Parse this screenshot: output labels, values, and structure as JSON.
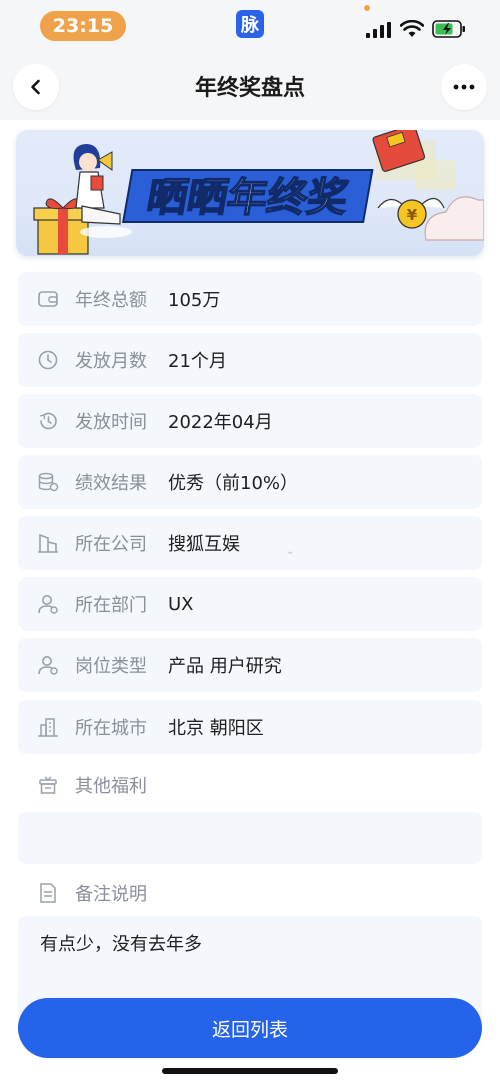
{
  "status_bar": {
    "time": "23:15",
    "app_badge": "脉",
    "icons": [
      "signal-icon",
      "wifi-icon",
      "battery-charging-icon"
    ]
  },
  "nav": {
    "title": "年终奖盘点",
    "back_icon": "chevron-left-icon",
    "more_icon": "more-horizontal-icon"
  },
  "banner": {
    "text": "晒晒年终奖",
    "colors": {
      "accent": "#2a5fd8",
      "envelope": "#e54b3c",
      "coin": "#f5c623"
    }
  },
  "fields": [
    {
      "icon": "wallet-icon",
      "label": "年终总额",
      "value": "105万"
    },
    {
      "icon": "clock-icon",
      "label": "发放月数",
      "value": "21个月"
    },
    {
      "icon": "history-icon",
      "label": "发放时间",
      "value": "2022年04月"
    },
    {
      "icon": "database-icon",
      "label": "绩效结果",
      "value": "优秀（前10%）"
    },
    {
      "icon": "building-icon",
      "label": "所在公司",
      "value": "搜狐互娱"
    },
    {
      "icon": "user-icon",
      "label": "所在部门",
      "value": "UX"
    },
    {
      "icon": "user-icon",
      "label": "岗位类型",
      "value": "产品 用户研究"
    },
    {
      "icon": "city-icon",
      "label": "所在城市",
      "value": "北京 朝阳区"
    }
  ],
  "benefits": {
    "icon": "gift-box-icon",
    "label": "其他福利",
    "value": ""
  },
  "notes": {
    "icon": "document-icon",
    "label": "备注说明",
    "value": "有点少，没有去年多"
  },
  "actions": {
    "return_label": "返回列表"
  },
  "colors": {
    "primary": "#2563ea",
    "row_bg": "#f4f7fc",
    "label": "#8a8f99"
  }
}
